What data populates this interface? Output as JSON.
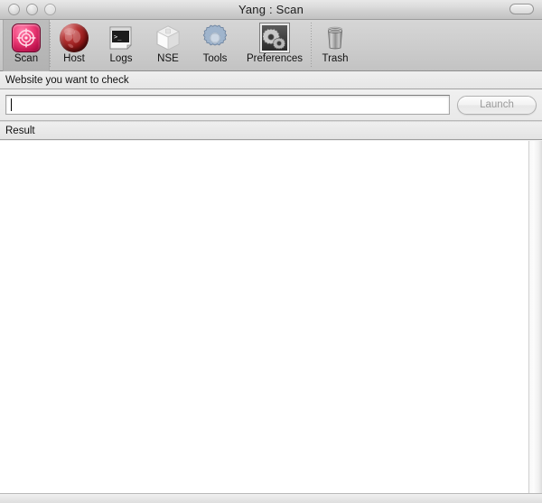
{
  "window": {
    "title": "Yang : Scan",
    "traffic_lights": [
      {
        "name": "close",
        "state": "inactive"
      },
      {
        "name": "minimize",
        "state": "inactive"
      },
      {
        "name": "zoom",
        "state": "inactive"
      }
    ],
    "toolbar_toggle": ""
  },
  "toolbar": {
    "items": [
      {
        "label": "Scan",
        "icon": "target-icon",
        "selected": true
      },
      {
        "label": "Host",
        "icon": "globe-icon",
        "selected": false
      },
      {
        "label": "Logs",
        "icon": "terminal-icon",
        "selected": false
      },
      {
        "label": "NSE",
        "icon": "box-icon",
        "selected": false
      },
      {
        "label": "Tools",
        "icon": "gear-icon",
        "selected": false
      },
      {
        "label": "Preferences",
        "icon": "preferences-icon",
        "selected": false
      },
      {
        "label": "Trash",
        "icon": "trash-icon",
        "selected": false
      }
    ]
  },
  "form": {
    "section_label": "Website you want to check",
    "input": {
      "value": "",
      "placeholder": ""
    },
    "launch_label": "Launch",
    "launch_enabled": false
  },
  "result": {
    "section_label": "Result",
    "content": ""
  },
  "colors": {
    "scan_accent": "#ef3f79",
    "host_accent": "#8d1616",
    "tools_accent": "#9fb4cc",
    "titlebar": "#d0d0d0",
    "toolbar": "#cdcdcd",
    "result_background": "#ffffff"
  }
}
